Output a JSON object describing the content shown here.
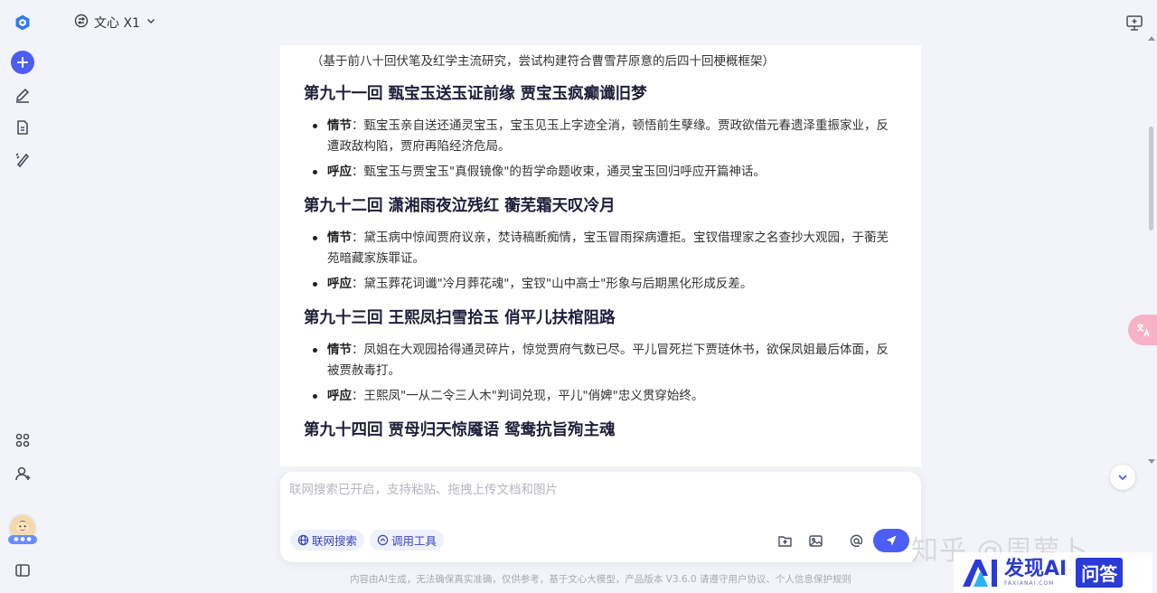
{
  "header": {
    "model_name": "文心 X1"
  },
  "conversation": {
    "intro": "（基于前八十回伏笔及红学主流研究，尝试构建符合曹雪芹原意的后四十回梗概框架）",
    "chapters": [
      {
        "title": "第九十一回 甄宝玉送玉证前缘 贾宝玉疯癫谶旧梦",
        "points": [
          {
            "label": "情节",
            "text": "：甄宝玉亲自送还通灵宝玉，宝玉见玉上字迹全消，顿悟前生孽缘。贾政欲借元春遗泽重振家业，反遭政敌构陷，贾府再陷经济危局。"
          },
          {
            "label": "呼应",
            "text": "：甄宝玉与贾宝玉\"真假镜像\"的哲学命题收束，通灵宝玉回归呼应开篇神话。"
          }
        ]
      },
      {
        "title": "第九十二回 潇湘雨夜泣残红 蘅芜霜天叹冷月",
        "points": [
          {
            "label": "情节",
            "text": "：黛玉病中惊闻贾府议亲，焚诗稿断痴情，宝玉冒雨探病遭拒。宝钗借理家之名查抄大观园，于蘅芜苑暗藏家族罪证。"
          },
          {
            "label": "呼应",
            "text": "：黛玉葬花词谶\"冷月葬花魂\"，宝钗\"山中高士\"形象与后期黑化形成反差。"
          }
        ]
      },
      {
        "title": "第九十三回 王熙凤扫雪拾玉 俏平儿扶棺阻路",
        "points": [
          {
            "label": "情节",
            "text": "：凤姐在大观园拾得通灵碎片，惊觉贾府气数已尽。平儿冒死拦下贾琏休书，欲保凤姐最后体面，反被贾赦毒打。"
          },
          {
            "label": "呼应",
            "text": "：王熙凤\"一从二令三人木\"判词兑现，平儿\"俏婢\"忠义贯穿始终。"
          }
        ]
      },
      {
        "title": "第九十四回 贾母归天惊魇语 鸳鸯抗旨殉主魂",
        "points": []
      }
    ]
  },
  "input": {
    "placeholder": "联网搜索已开启，支持粘贴、拖拽上传文档和图片",
    "chip_search": "联网搜索",
    "chip_tools": "调用工具"
  },
  "footer": {
    "text": "内容由AI生成，无法确保真实准确，仅供参考，基于文心大模型，产品版本 V3.6.0 请遵守用户协议、个人信息保护规则"
  },
  "watermarks": {
    "zhihu": "知乎 @周萝卜",
    "faxian_title": "发现AI",
    "faxian_sub": "FAXIANAI.COM",
    "faxian_box": "问答"
  },
  "colors": {
    "accent": "#4c5ef5",
    "chip_text": "#3b47b5",
    "translate_pink": "#f7b2c7"
  }
}
